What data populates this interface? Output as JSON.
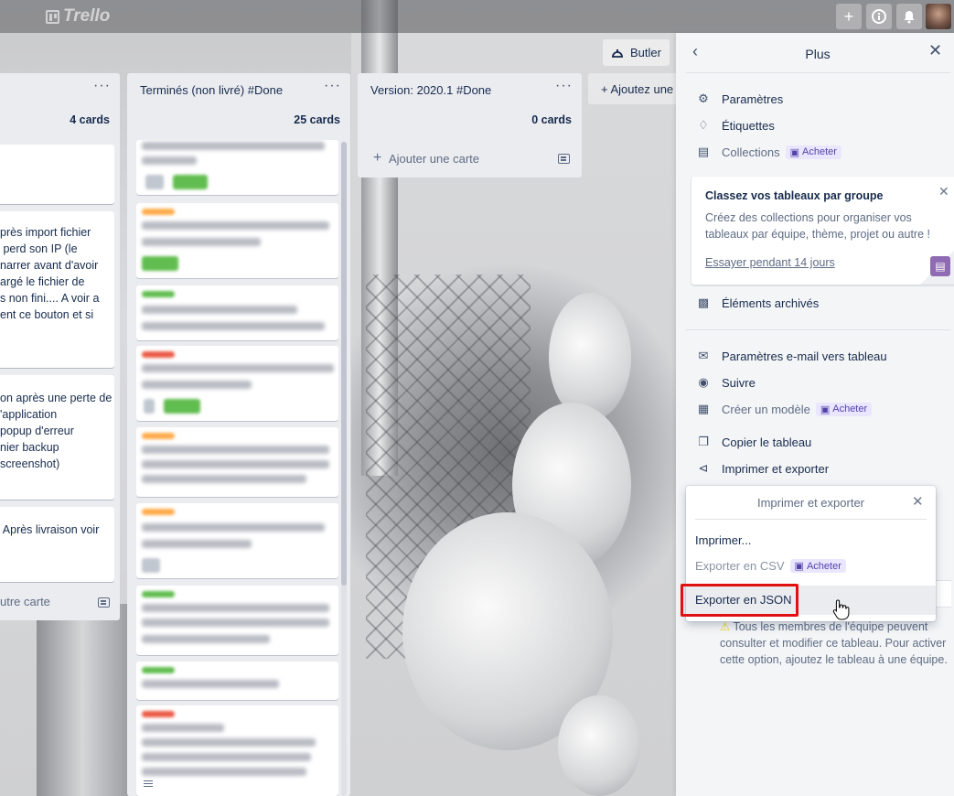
{
  "header": {
    "logo_text": "Trello",
    "buttons": [
      "+",
      "i",
      "bell"
    ]
  },
  "board": {
    "butler_label": "Butler",
    "add_list_label": "Ajoutez une",
    "lists": [
      {
        "title": "",
        "count": "4 cards",
        "cards": [
          "",
          "près import fichier\n perd son IP (le\nnarrer avant d'avoir\nargé le fichier de\ns non fini.... A voir a\nent ce bouton et si",
          "on après une perte de\n'application\npopup d'erreur\nnier backup\nscreenshot)",
          " Après livraison voir"
        ],
        "add_card": "utre carte"
      },
      {
        "title": "Terminés (non livré) #Done",
        "count": "25 cards"
      },
      {
        "title": "Version: 2020.1 #Done",
        "count": "0 cards",
        "add_card": "Ajouter une carte"
      }
    ]
  },
  "panel": {
    "title": "Plus",
    "items": {
      "parametres": "Paramètres",
      "etiquettes": "Étiquettes",
      "collections": "Collections",
      "archives": "Éléments archivés",
      "email": "Paramètres e-mail vers tableau",
      "suivre": "Suivre",
      "modele": "Créer un modèle",
      "copier": "Copier le tableau",
      "imprimer": "Imprimer et exporter"
    },
    "buy_label": "Acheter",
    "promo": {
      "title": "Classez vos tableaux par groupe",
      "body": "Créez des collections pour organiser vos tableaux par équipe, thème, projet ou autre !",
      "link": "Essayer pendant 14 jours"
    },
    "warning": "Tous les membres de l'équipe peuvent consulter et modifier ce tableau. Pour activer cette option, ajoutez le tableau à une équipe."
  },
  "popup": {
    "title": "Imprimer et exporter",
    "print": "Imprimer...",
    "csv": "Exporter en CSV",
    "json": "Exporter en JSON"
  },
  "colors": {
    "highlight": "#e01010",
    "buy_bg": "#eae6ff",
    "buy_text": "#5243aa"
  }
}
